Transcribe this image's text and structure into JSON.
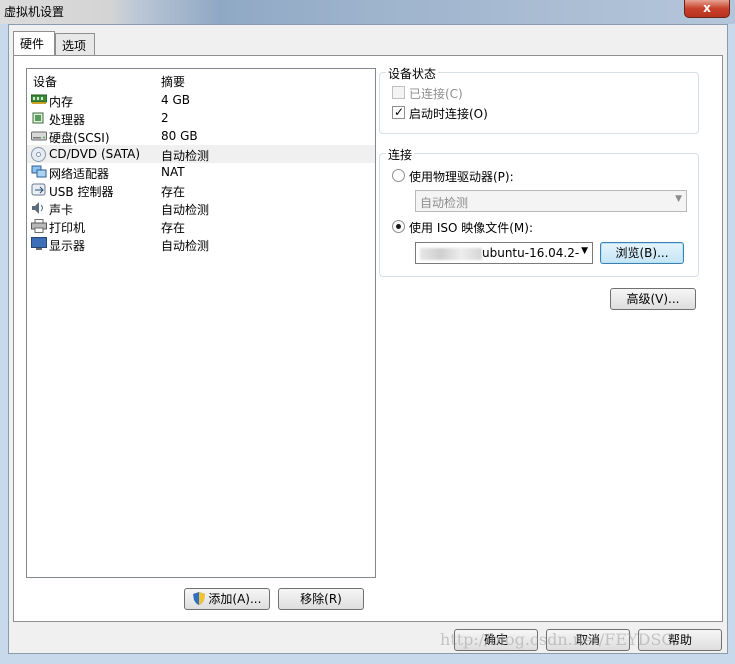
{
  "window": {
    "title": "虚拟机设置",
    "close_label": "x"
  },
  "tabs": [
    {
      "label": "硬件"
    },
    {
      "label": "选项"
    }
  ],
  "device_list": {
    "columns": [
      "设备",
      "摘要"
    ],
    "rows": [
      {
        "name": "内存",
        "summary": "4 GB",
        "icon": "memory-icon"
      },
      {
        "name": "处理器",
        "summary": "2",
        "icon": "processor-icon"
      },
      {
        "name": "硬盘(SCSI)",
        "summary": "80 GB",
        "icon": "hard-disk-icon"
      },
      {
        "name": "CD/DVD (SATA)",
        "summary": "自动检测",
        "icon": "cd-dvd-icon"
      },
      {
        "name": "网络适配器",
        "summary": "NAT",
        "icon": "network-adapter-icon"
      },
      {
        "name": "USB 控制器",
        "summary": "存在",
        "icon": "usb-icon"
      },
      {
        "name": "声卡",
        "summary": "自动检测",
        "icon": "sound-card-icon"
      },
      {
        "name": "打印机",
        "summary": "存在",
        "icon": "printer-icon"
      },
      {
        "name": "显示器",
        "summary": "自动检测",
        "icon": "display-icon"
      }
    ],
    "selected_index": 3
  },
  "device_buttons": {
    "add": "添加(A)...",
    "remove": "移除(R)"
  },
  "device_status": {
    "title": "设备状态",
    "connected": {
      "label": "已连接(C)",
      "checked": false,
      "enabled": false
    },
    "connect_on_power": {
      "label": "启动时连接(O)",
      "checked": true,
      "enabled": true
    }
  },
  "connection": {
    "title": "连接",
    "physical": {
      "label": "使用物理驱动器(P):",
      "selected": false,
      "value": "自动检测"
    },
    "iso": {
      "label": "使用 ISO 映像文件(M):",
      "selected": true,
      "value_visible": "ubuntu-16.04.2-"
    },
    "browse": "浏览(B)..."
  },
  "advanced": "高级(V)...",
  "footer": {
    "ok": "确定",
    "cancel": "取消",
    "help": "帮助"
  },
  "watermark": "http://blog.csdn.net/FEYDSO"
}
